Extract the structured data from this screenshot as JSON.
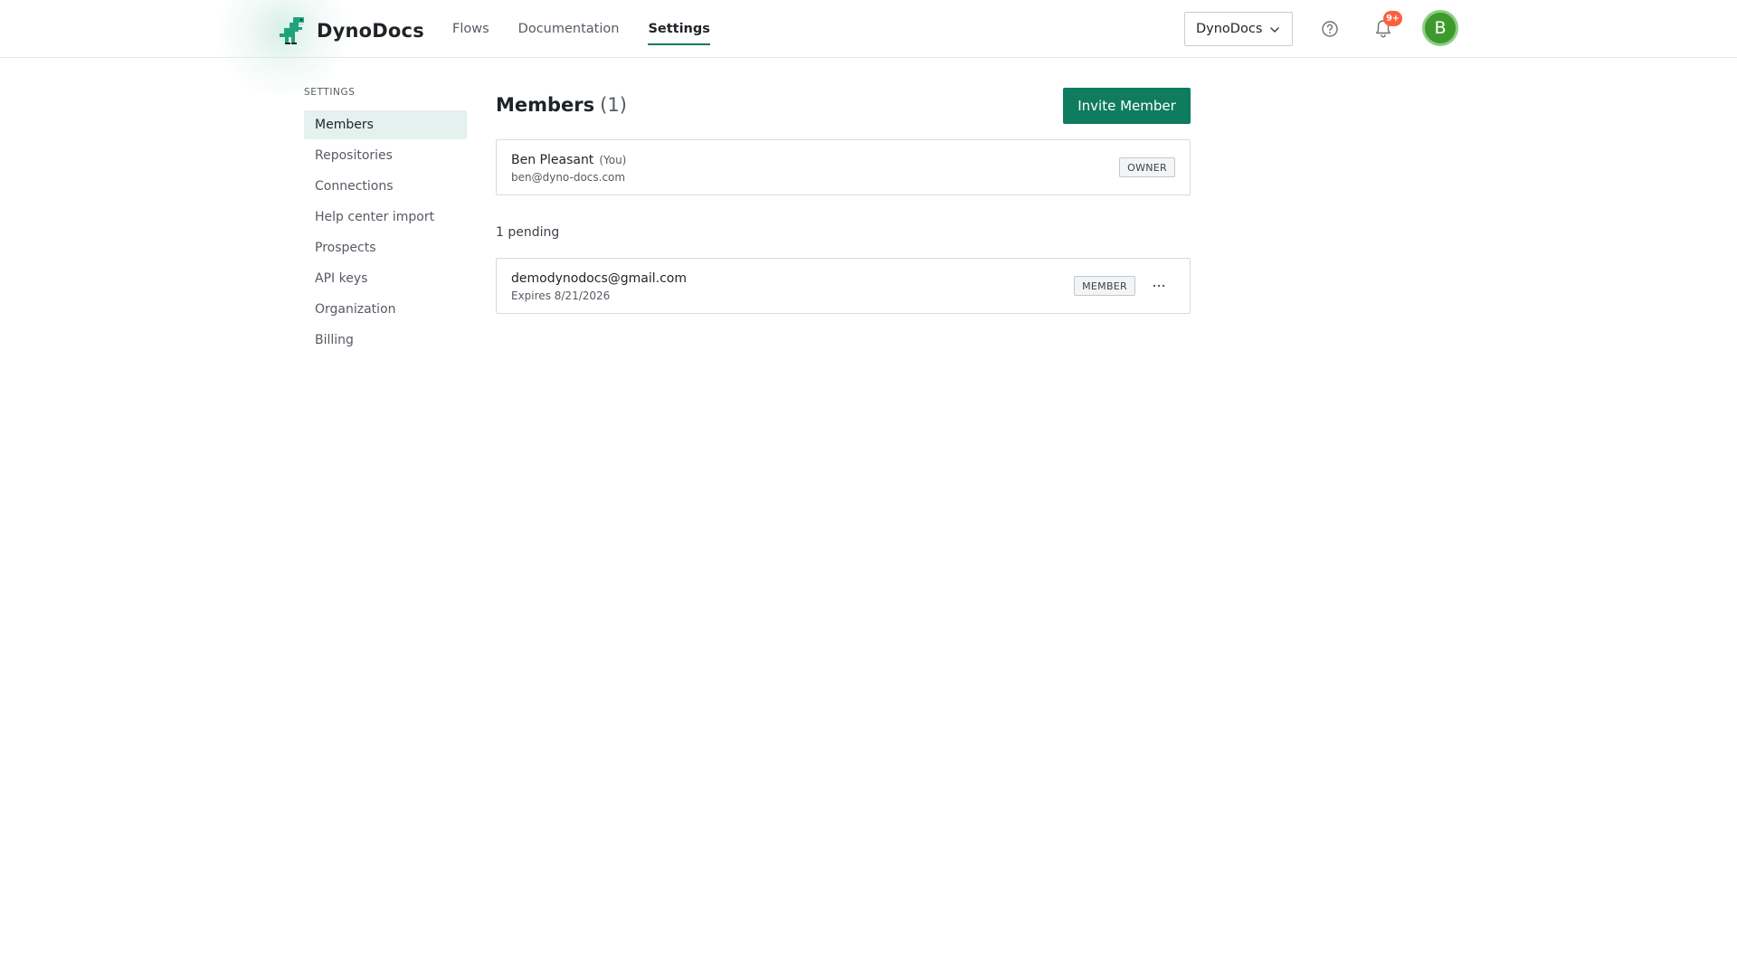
{
  "app": {
    "name": "DynoDocs",
    "brand_color": "#0f7b5f"
  },
  "nav": {
    "items": [
      {
        "label": "Flows"
      },
      {
        "label": "Documentation"
      },
      {
        "label": "Settings",
        "active": true
      }
    ]
  },
  "header": {
    "org_select_value": "DynoDocs",
    "notification_count": "9+",
    "avatar_initial": "B",
    "icons": [
      "help-icon",
      "bell-icon",
      "chevron-down-icon"
    ]
  },
  "sidebar": {
    "heading": "SETTINGS",
    "items": [
      {
        "label": "Members",
        "active": true
      },
      {
        "label": "Repositories"
      },
      {
        "label": "Connections"
      },
      {
        "label": "Help center import"
      },
      {
        "label": "Prospects"
      },
      {
        "label": "API keys"
      },
      {
        "label": "Organization"
      },
      {
        "label": "Billing"
      }
    ]
  },
  "main": {
    "title": "Members",
    "count": "(1)",
    "invite_label": "Invite Member",
    "members": [
      {
        "name": "Ben Pleasant",
        "you_tag": "(You)",
        "email": "ben@dyno-docs.com",
        "role": "OWNER"
      }
    ],
    "pending_label": "1 pending",
    "pending": [
      {
        "email": "demodynodocs@gmail.com",
        "expires": "Expires 8/21/2026",
        "role": "MEMBER"
      }
    ]
  }
}
